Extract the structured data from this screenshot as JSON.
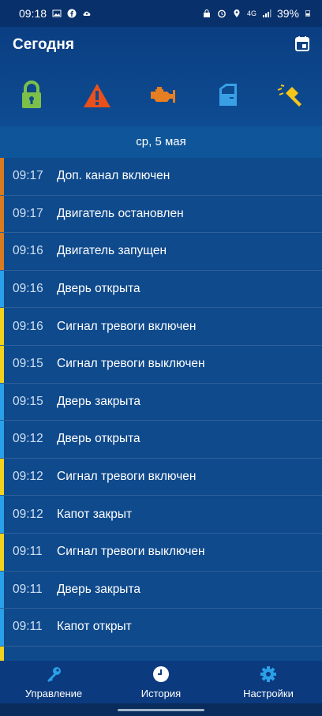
{
  "statusbar": {
    "time": "09:18",
    "battery": "39%",
    "network": "4G"
  },
  "header": {
    "title": "Сегодня"
  },
  "status_icons": [
    {
      "name": "lock",
      "color": "#7cc04a"
    },
    {
      "name": "alarm-warning",
      "color": "#e8501c"
    },
    {
      "name": "engine",
      "color": "#e67e22"
    },
    {
      "name": "door",
      "color": "#3aa0e6"
    },
    {
      "name": "hood-hammer",
      "color": "#f5c518"
    }
  ],
  "date": "ср, 5 мая",
  "colors": {
    "orange": "#d97b1f",
    "blue": "#2aa0e8",
    "yellow": "#f2d21c"
  },
  "events": [
    {
      "time": "09:17",
      "text": "Доп. канал включен",
      "color": "orange"
    },
    {
      "time": "09:17",
      "text": "Двигатель остановлен",
      "color": "orange"
    },
    {
      "time": "09:16",
      "text": "Двигатель запущен",
      "color": "orange"
    },
    {
      "time": "09:16",
      "text": "Дверь открыта",
      "color": "blue"
    },
    {
      "time": "09:16",
      "text": "Сигнал тревоги включен",
      "color": "yellow"
    },
    {
      "time": "09:15",
      "text": "Сигнал тревоги выключен",
      "color": "yellow"
    },
    {
      "time": "09:15",
      "text": "Дверь закрыта",
      "color": "blue"
    },
    {
      "time": "09:12",
      "text": "Дверь открыта",
      "color": "blue"
    },
    {
      "time": "09:12",
      "text": "Сигнал тревоги включен",
      "color": "yellow"
    },
    {
      "time": "09:12",
      "text": "Капот закрыт",
      "color": "blue"
    },
    {
      "time": "09:11",
      "text": "Сигнал тревоги выключен",
      "color": "yellow"
    },
    {
      "time": "09:11",
      "text": "Дверь закрыта",
      "color": "blue"
    },
    {
      "time": "09:11",
      "text": "Капот открыт",
      "color": "blue"
    },
    {
      "time": "",
      "text": "",
      "color": "yellow"
    }
  ],
  "nav": [
    {
      "label": "Управление",
      "icon": "key-icon"
    },
    {
      "label": "История",
      "icon": "clock-icon"
    },
    {
      "label": "Настройки",
      "icon": "gear-icon"
    }
  ]
}
